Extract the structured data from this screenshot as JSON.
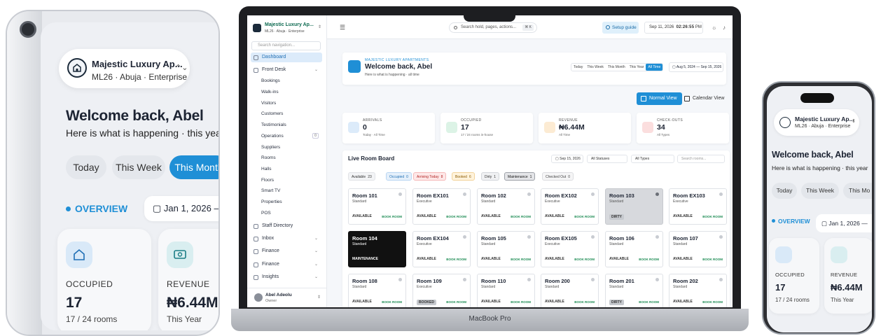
{
  "tablet": {
    "property_name": "Majestic Luxury Ap...",
    "property_sub": "ML26 · Abuja · Enterprise",
    "welcome": "Welcome back, Abel",
    "happening": "Here is what is happening · this year",
    "pills": [
      "Today",
      "This Week",
      "This Month"
    ],
    "overview": "OVERVIEW",
    "date_range": "Jan 1, 2026 — S",
    "cards": [
      {
        "label": "OCCUPIED",
        "value": "17",
        "sub": "17 / 24 rooms"
      },
      {
        "label": "REVENUE",
        "value": "₦6.44M",
        "sub": "This Year"
      }
    ]
  },
  "laptop": {
    "brand": "MacBook Pro",
    "sidebar": {
      "property_name": "Majestic Luxury Ap...",
      "property_sub": "ML26 · Abuja · Enterprise",
      "search_placeholder": "Search navigation...",
      "items": [
        {
          "label": "Dashboard"
        },
        {
          "label": "Front Desk"
        },
        {
          "label": "Staff Directory"
        },
        {
          "label": "Inbox"
        },
        {
          "label": "Finance"
        },
        {
          "label": "Finance"
        },
        {
          "label": "Insights"
        }
      ],
      "front_desk_sub": [
        "Bookings",
        "Walk-ins",
        "Visitors",
        "Customers",
        "Testimonials",
        "Operations",
        "Suppliers",
        "Rooms",
        "Halls",
        "Floors",
        "Smart TV",
        "Properties",
        "POS"
      ],
      "operations_badge": "0",
      "user_name": "Abel Adeolu",
      "user_role": "Owner"
    },
    "topbar": {
      "search": "Search hold, pages, actions...",
      "search_kbd": "⌘ K",
      "setup": "Setup guide",
      "clock_date": "Sep 11, 2026",
      "clock_time": "02:26:55",
      "clock_ampm": "PM"
    },
    "welcome": {
      "brand": "MAJESTIC LUXURY APARTMENTS",
      "title": "Welcome back, Abel",
      "subtitle": "Here is what is happening · all time",
      "tabs": [
        "Today",
        "This Week",
        "This Month",
        "This Year",
        "All Time"
      ],
      "date_range": "Aug 5, 2024 — Sep 15, 2026"
    },
    "views": {
      "normal": "Normal View",
      "calendar": "Calendar View"
    },
    "stats": [
      {
        "label": "ARRIVALS",
        "value": "0",
        "sub": "Today · All Time"
      },
      {
        "label": "OCCUPIED",
        "value": "17",
        "sub": "17 / 24 rooms in-house"
      },
      {
        "label": "REVENUE",
        "value": "₦6.44M",
        "sub": "All Time"
      },
      {
        "label": "CHECK-OUTS",
        "value": "34",
        "sub": "All Types"
      }
    ],
    "board": {
      "title": "Live Room Board",
      "date": "Sep 15, 2026",
      "statuses": "All Statuses",
      "types": "All Types",
      "search_placeholder": "Search rooms...",
      "chips": [
        {
          "label": "Available",
          "count": "23"
        },
        {
          "label": "Occupied",
          "count": "0"
        },
        {
          "label": "Arriving Today",
          "count": "8"
        },
        {
          "label": "Booked",
          "count": "6"
        },
        {
          "label": "Dirty",
          "count": "1"
        },
        {
          "label": "Maintenance",
          "count": "1"
        },
        {
          "label": "Checked Out",
          "count": "0"
        }
      ],
      "rooms": [
        {
          "name": "Room 101",
          "type": "Standard",
          "status": "AVAILABLE",
          "action": "BOOK ROOM"
        },
        {
          "name": "Room EX101",
          "type": "Executive",
          "status": "AVAILABLE",
          "action": "BOOK ROOM"
        },
        {
          "name": "Room 102",
          "type": "Standard",
          "status": "AVAILABLE",
          "action": "BOOK ROOM"
        },
        {
          "name": "Room EX102",
          "type": "Executive",
          "status": "AVAILABLE",
          "action": "BOOK ROOM"
        },
        {
          "name": "Room 103",
          "type": "Standard",
          "status": "DIRTY",
          "action": ""
        },
        {
          "name": "Room EX103",
          "type": "Executive",
          "status": "AVAILABLE",
          "action": "BOOK ROOM"
        },
        {
          "name": "Room 104",
          "type": "Standard",
          "status": "MAINTENANCE",
          "action": ""
        },
        {
          "name": "Room EX104",
          "type": "Executive",
          "status": "AVAILABLE",
          "action": "BOOK ROOM"
        },
        {
          "name": "Room 105",
          "type": "Standard",
          "status": "AVAILABLE",
          "action": "BOOK ROOM"
        },
        {
          "name": "Room EX105",
          "type": "Executive",
          "status": "AVAILABLE",
          "action": "BOOK ROOM"
        },
        {
          "name": "Room 106",
          "type": "Standard",
          "status": "AVAILABLE",
          "action": "BOOK ROOM"
        },
        {
          "name": "Room 107",
          "type": "Standard",
          "status": "AVAILABLE",
          "action": "BOOK ROOM"
        },
        {
          "name": "Room 108",
          "type": "Standard",
          "status": "AVAILABLE",
          "action": "BOOK ROOM"
        },
        {
          "name": "Room 109",
          "type": "Executive",
          "status": "BOOKED",
          "action": "BOOK ROOM"
        },
        {
          "name": "Room 110",
          "type": "Standard",
          "status": "AVAILABLE",
          "action": "BOOK ROOM"
        },
        {
          "name": "Room 200",
          "type": "Standard",
          "status": "AVAILABLE",
          "action": "BOOK ROOM"
        },
        {
          "name": "Room 201",
          "type": "Standard",
          "status": "DIRTY",
          "action": "BOOK ROOM"
        },
        {
          "name": "Room 202",
          "type": "Standard",
          "status": "AVAILABLE",
          "action": "BOOK ROOM"
        }
      ]
    }
  },
  "phone": {
    "property_name": "Majestic Luxury Ap...",
    "property_sub": "ML26 · Abuja · Enterprise",
    "welcome": "Welcome back, Abel",
    "happening": "Here is what is happening · this year",
    "pills": [
      "Today",
      "This Week",
      "This Mo"
    ],
    "overview": "OVERVIEW",
    "date_range": "Jan 1, 2026 —",
    "cards": [
      {
        "label": "OCCUPIED",
        "value": "17",
        "sub": "17 / 24 rooms"
      },
      {
        "label": "REVENUE",
        "value": "₦6.44M",
        "sub": "This Year"
      }
    ]
  },
  "colors": {
    "accent": "#1f8fd6",
    "brand_green": "#0f6b52",
    "book": "#1a8a52"
  }
}
